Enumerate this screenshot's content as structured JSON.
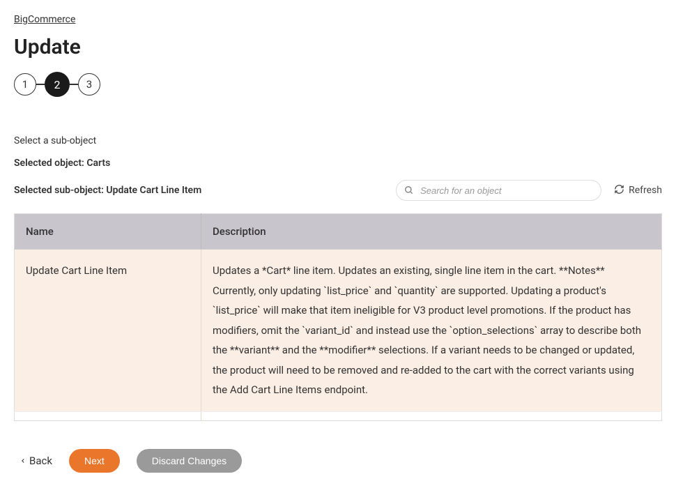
{
  "breadcrumb": {
    "label": "BigCommerce"
  },
  "page_title": "Update",
  "stepper": {
    "steps": [
      "1",
      "2",
      "3"
    ],
    "active_index": 1
  },
  "section_label": "Select a sub-object",
  "selected_object_line": "Selected object: Carts",
  "selected_subobject_line": "Selected sub-object: Update Cart Line Item",
  "search": {
    "placeholder": "Search for an object"
  },
  "refresh_label": "Refresh",
  "table": {
    "headers": {
      "name": "Name",
      "description": "Description"
    },
    "row": {
      "name": "Update Cart Line Item",
      "description": "Updates a *Cart* line item. Updates an existing, single line item in the cart. **Notes** Currently, only updating `list_price` and `quantity` are supported. Updating a product's `list_price` will make that item ineligible for V3 product level promotions. If the product has modifiers, omit the `variant_id` and instead use the `option_selections` array to describe both the **variant** and the **modifier** selections. If a variant needs to be changed or updated, the product will need to be removed and re-added to the cart with the correct variants using the Add Cart Line Items endpoint."
    }
  },
  "actions": {
    "back": "Back",
    "next": "Next",
    "discard": "Discard Changes"
  }
}
